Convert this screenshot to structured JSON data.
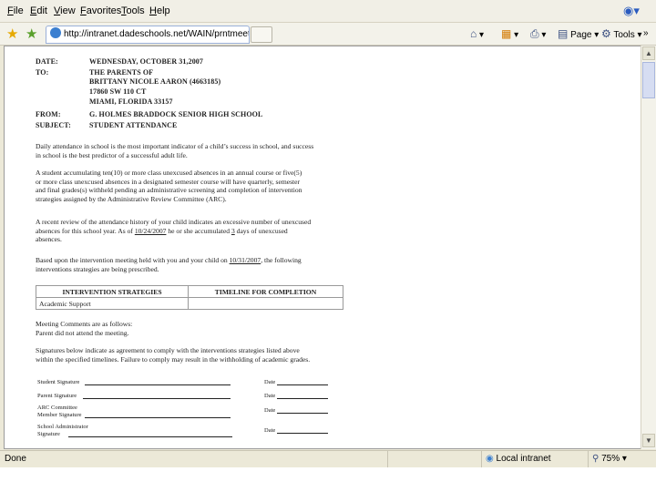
{
  "menu": [
    "File",
    "Edit",
    "View",
    "Favorites",
    "Tools",
    "Help"
  ],
  "tab": {
    "title": "http://intranet.dadeschools.net/WAIN/prntmeeting.a..."
  },
  "toolbar": {
    "page": "Page",
    "tools": "Tools"
  },
  "status": {
    "left": "Done",
    "zone": "Local intranet",
    "zoom": "75%"
  },
  "letter": {
    "date_label": "DATE:",
    "date_value": "WEDNESDAY, OCTOBER 31,2007",
    "to_label": "TO:",
    "to_lines": [
      "THE PARENTS OF",
      "BRITTANY NICOLE AARON (4663185)",
      "17860 SW 110 CT",
      "MIAMI, FLORIDA 33157"
    ],
    "from_label": "FROM:",
    "from_value": "G. HOLMES BRADDOCK SENIOR HIGH SCHOOL",
    "subject_label": "SUBJECT:",
    "subject_value": "STUDENT ATTENDANCE",
    "p1_line1": "Daily attendance in school is the most important indicator of a child’s success in school, and success",
    "p1_line2": "in school is the best predictor of a successful adult life.",
    "p2_line1": "A student accumulating ten(10) or more class unexcused absences in an annual course or five(5)",
    "p2_line2": "or more class unexcused absences in a designated semester course will have quarterly, semester",
    "p2_line3": "and final grades(s) withheld pending an administrative screening and completion of intervention",
    "p2_line4": "strategies assigned by the Administrative Review Committee (ARC).",
    "p3_line1": "A recent review of the attendance history of your child indicates an excessive number of unexcused",
    "p3_line2_a": "absences for this school year. As of",
    "p3_date": "10/24/2007",
    "p3_line2_b": "he or she accumulated",
    "p3_count": "3",
    "p3_line2_c": "days of unexcused",
    "p3_line3": "absences.",
    "p4_line1_a": "Based upon the intervention meeting held with you and your child on",
    "p4_date": "10/31/2007",
    "p4_line1_b": ", the following",
    "p4_line2": "interventions strategies are being prescribed.",
    "table_headers": [
      "INTERVENTION STRATEGIES",
      "TIMELINE FOR COMPLETION"
    ],
    "table_rows": [
      [
        "Academic Support",
        ""
      ]
    ],
    "comments_label": "Meeting Comments are as follows:",
    "comments_text": "Parent did not attend the meeting.",
    "p5_line1": "Signatures below indicate as agreement to comply with the interventions strategies listed above",
    "p5_line2": "within the specified timelines. Failure to comply may result in the withholding of academic grades.",
    "sig_student": "Student Signature",
    "sig_parent": "Parent Signature",
    "sig_arc_1": "ARC Committee",
    "sig_arc_2": "Member Signature",
    "sig_admin_1": "School Administrator",
    "sig_admin_2": "Signature",
    "date_word": "Date"
  }
}
